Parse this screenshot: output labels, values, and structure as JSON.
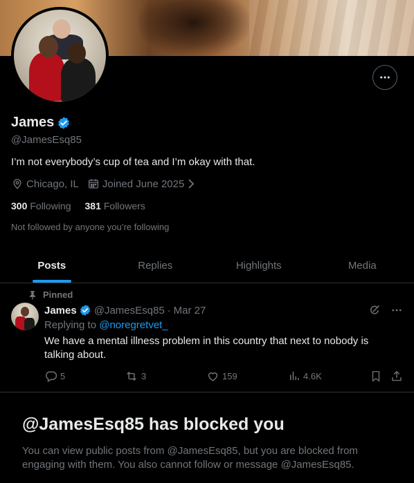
{
  "profile": {
    "name": "James",
    "handle": "@JamesEsq85",
    "bio": "I’m not everybody’s cup of tea and I’m okay with that.",
    "location": "Chicago, IL",
    "joined": "Joined June 2025",
    "following_count": "300",
    "following_label": "Following",
    "followers_count": "381",
    "followers_label": "Followers",
    "not_followed_text": "Not followed by anyone you’re following"
  },
  "tabs": [
    {
      "label": "Posts",
      "active": true
    },
    {
      "label": "Replies",
      "active": false
    },
    {
      "label": "Highlights",
      "active": false
    },
    {
      "label": "Media",
      "active": false
    }
  ],
  "post": {
    "pinned_label": "Pinned",
    "author_name": "James",
    "author_handle": "@JamesEsq85",
    "separator": "·",
    "date": "Mar 27",
    "replying_prefix": "Replying to",
    "replying_mention": "@noregretvet_",
    "text": "We have a mental illness problem in this country that next to nobody is talking about.",
    "replies": "5",
    "reposts": "3",
    "likes": "159",
    "views": "4.6K"
  },
  "blocked": {
    "title": "@JamesEsq85 has blocked you",
    "description": "You can view public posts from @JamesEsq85, but you are blocked from engaging with them. You also cannot follow or message @JamesEsq85."
  },
  "colors": {
    "background": "#000000",
    "primary_text": "#e7e9ea",
    "secondary_text": "#71767b",
    "accent": "#1d9bf0",
    "border": "#2f3336"
  },
  "icons": [
    "more-icon",
    "verified-badge-icon",
    "location-icon",
    "calendar-icon",
    "chevron-right-icon",
    "pin-icon",
    "grok-icon",
    "reply-icon",
    "repost-icon",
    "like-icon",
    "views-icon",
    "bookmark-icon",
    "share-icon"
  ]
}
